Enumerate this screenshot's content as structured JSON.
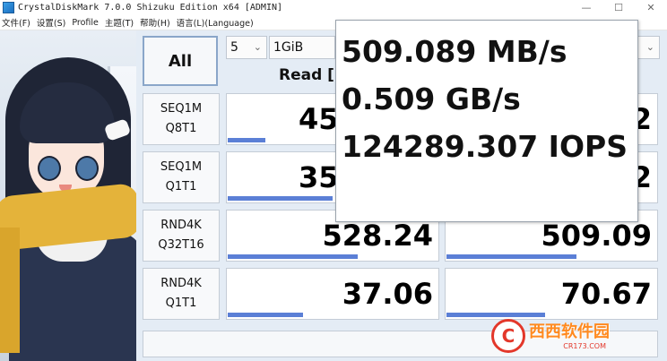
{
  "window": {
    "title": "CrystalDiskMark 7.0.0 Shizuku Edition x64 [ADMIN]",
    "minimize_glyph": "—",
    "maximize_glyph": "☐",
    "close_glyph": "✕"
  },
  "menu": [
    "文件(F)",
    "设置(S)",
    "Profile",
    "主题(T)",
    "帮助(H)",
    "语言(L)(Language)"
  ],
  "controls": {
    "all_label": "All",
    "count_value": "5",
    "size_value": "1GiB"
  },
  "columns": {
    "read_header": "Read ["
  },
  "rows": [
    {
      "line1": "SEQ1M",
      "line2": "Q8T1",
      "read": "45",
      "write": "2",
      "read_fraction": 0.18,
      "write_fraction": 0.02
    },
    {
      "line1": "SEQ1M",
      "line2": "Q1T1",
      "read": "35",
      "write": "2",
      "read_fraction": 0.5,
      "write_fraction": 0.02
    },
    {
      "line1": "RND4K",
      "line2": "Q32T16",
      "read": "528.24",
      "write": "509.09",
      "read_fraction": 0.62,
      "write_fraction": 0.62
    },
    {
      "line1": "RND4K",
      "line2": "Q1T1",
      "read": "37.06",
      "write": "70.67",
      "read_fraction": 0.36,
      "write_fraction": 0.47
    }
  ],
  "tooltip": {
    "lines": [
      "509.089 MB/s",
      "0.509 GB/s",
      "124289.307 IOPS"
    ]
  },
  "watermark": {
    "main": "西西软件园",
    "sub": "CR173.COM"
  },
  "colors": {
    "bar": "#5b7fd6",
    "accent_border": "#8aa6c9"
  }
}
